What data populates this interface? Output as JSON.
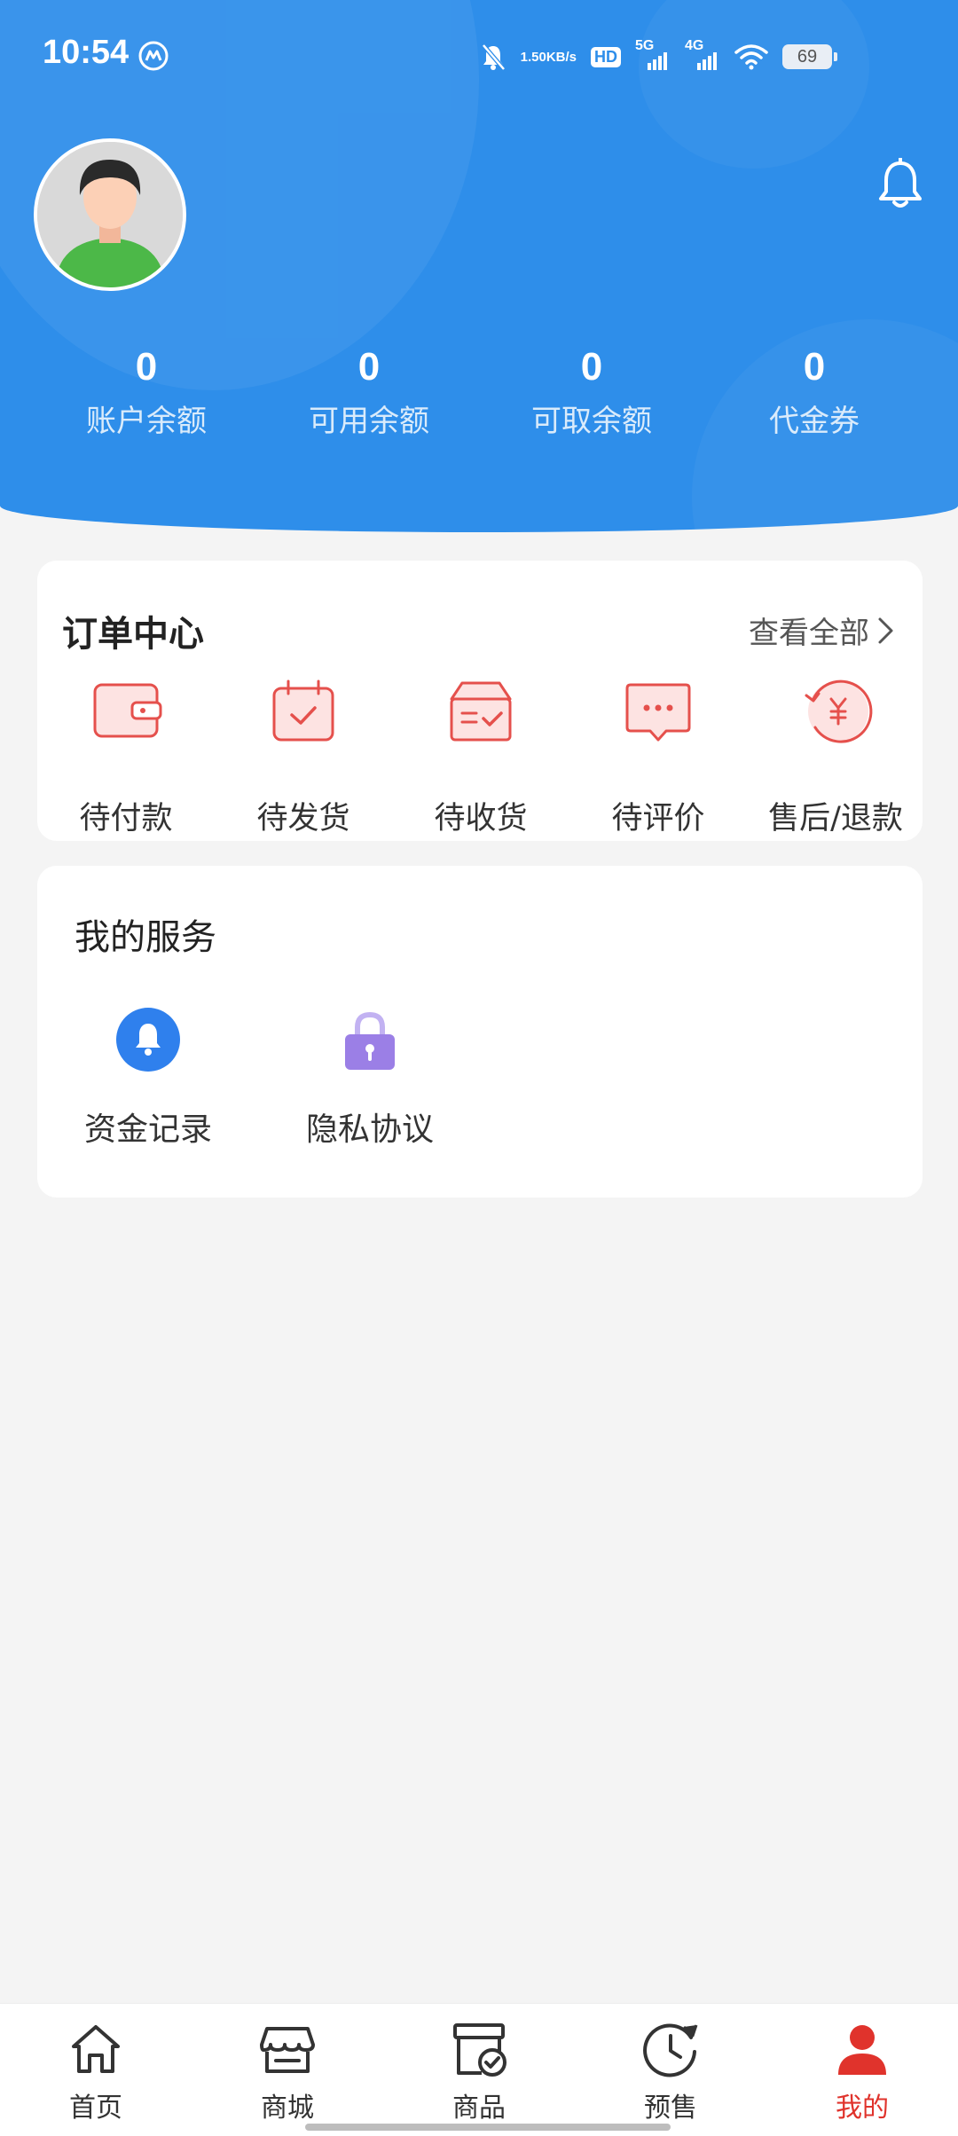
{
  "status_bar": {
    "time": "10:54",
    "net_speed_value": "1.50",
    "net_speed_unit": "KB/s",
    "hd_label": "HD",
    "sig1_label": "5G",
    "sig2_label": "4G",
    "battery": "69"
  },
  "account": {
    "stats": [
      {
        "value": "0",
        "label": "账户余额"
      },
      {
        "value": "0",
        "label": "可用余额"
      },
      {
        "value": "0",
        "label": "可取余额"
      },
      {
        "value": "0",
        "label": "代金券"
      }
    ]
  },
  "order_center": {
    "title": "订单中心",
    "view_all": "查看全部",
    "items": [
      {
        "label": "待付款",
        "icon": "wallet-icon"
      },
      {
        "label": "待发货",
        "icon": "calendar-check-icon"
      },
      {
        "label": "待收货",
        "icon": "box-check-icon"
      },
      {
        "label": "待评价",
        "icon": "chat-bubble-icon"
      },
      {
        "label": "售后/退款",
        "icon": "refund-yen-icon"
      }
    ]
  },
  "services": {
    "title": "我的服务",
    "items": [
      {
        "label": "资金记录",
        "icon": "bell-icon"
      },
      {
        "label": "隐私协议",
        "icon": "lock-icon"
      }
    ]
  },
  "bottom_nav": {
    "items": [
      {
        "label": "首页",
        "icon": "home-icon"
      },
      {
        "label": "商城",
        "icon": "store-icon"
      },
      {
        "label": "商品",
        "icon": "product-icon"
      },
      {
        "label": "预售",
        "icon": "clock-icon"
      },
      {
        "label": "我的",
        "icon": "user-icon"
      }
    ],
    "active_index": 4
  },
  "colors": {
    "brand_blue": "#2e8eea",
    "accent_red": "#e0332c",
    "order_icon_red": "#e5504c",
    "lock_purple": "#9b7fe6",
    "bell_blue": "#2f80ed"
  }
}
